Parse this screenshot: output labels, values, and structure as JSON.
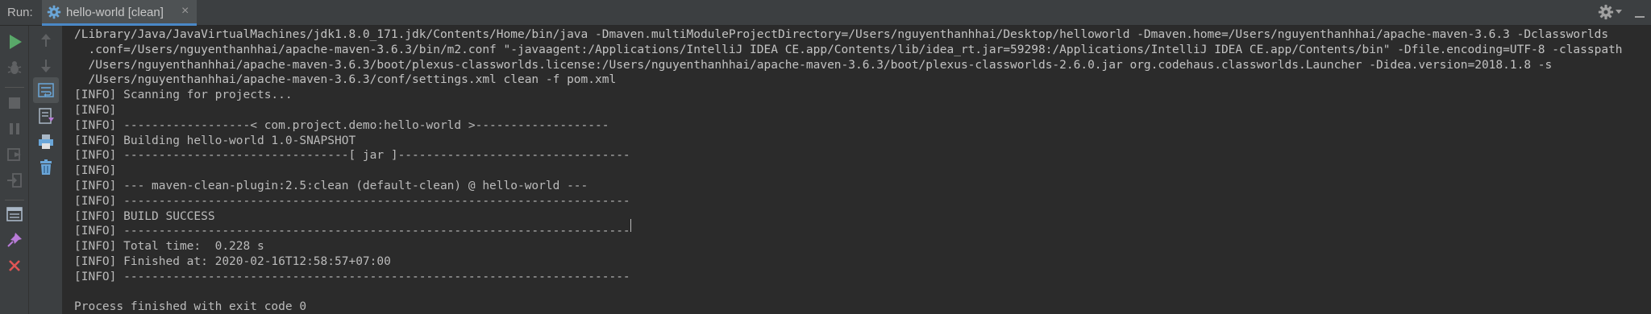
{
  "header": {
    "run_label": "Run:",
    "tab_title": "hello-world [clean]",
    "tab_close": "×",
    "icons": {
      "tab": "gear-icon",
      "settings": "gear-icon",
      "settings_dropdown": "chevron-down-icon",
      "hide": "hide-panel-icon"
    }
  },
  "left_toolbar": {
    "buttons": [
      {
        "name": "rerun-icon",
        "color": "#59a869"
      },
      {
        "name": "debug-disabled-icon",
        "color": "#6e6e6e"
      },
      {
        "name": "stop-icon",
        "color": "#6e6e6e"
      },
      {
        "name": "pause-icon",
        "color": "#6e6e6e"
      },
      {
        "name": "restore-layout-icon",
        "color": "#6e6e6e"
      },
      {
        "name": "login-icon",
        "color": "#6e6e6e"
      },
      {
        "name": "layout-icon",
        "color": "#a9b7c6"
      },
      {
        "name": "pin-icon",
        "color": "#b97cd9"
      },
      {
        "name": "close-icon",
        "color": "#e05555"
      }
    ]
  },
  "second_toolbar": {
    "buttons": [
      {
        "name": "up-arrow-icon"
      },
      {
        "name": "down-arrow-icon"
      },
      {
        "name": "soft-wrap-icon"
      },
      {
        "name": "scroll-to-end-icon"
      },
      {
        "name": "print-icon"
      },
      {
        "name": "trash-icon"
      }
    ]
  },
  "console": {
    "lines": [
      "/Library/Java/JavaVirtualMachines/jdk1.8.0_171.jdk/Contents/Home/bin/java -Dmaven.multiModuleProjectDirectory=/Users/nguyenthanhhai/Desktop/helloworld -Dmaven.home=/Users/nguyenthanhhai/apache-maven-3.6.3 -Dclassworlds",
      "  .conf=/Users/nguyenthanhhai/apache-maven-3.6.3/bin/m2.conf \"-javaagent:/Applications/IntelliJ IDEA CE.app/Contents/lib/idea_rt.jar=59298:/Applications/IntelliJ IDEA CE.app/Contents/bin\" -Dfile.encoding=UTF-8 -classpath",
      "  /Users/nguyenthanhhai/apache-maven-3.6.3/boot/plexus-classworlds.license:/Users/nguyenthanhhai/apache-maven-3.6.3/boot/plexus-classworlds-2.6.0.jar org.codehaus.classworlds.Launcher -Didea.version=2018.1.8 -s",
      "  /Users/nguyenthanhhai/apache-maven-3.6.3/conf/settings.xml clean -f pom.xml",
      "[INFO] Scanning for projects...",
      "[INFO]",
      "[INFO] ------------------< com.project.demo:hello-world >-------------------",
      "[INFO] Building hello-world 1.0-SNAPSHOT",
      "[INFO] --------------------------------[ jar ]---------------------------------",
      "[INFO]",
      "[INFO] --- maven-clean-plugin:2.5:clean (default-clean) @ hello-world ---",
      "[INFO] ------------------------------------------------------------------------",
      "[INFO] BUILD SUCCESS",
      "[INFO] ------------------------------------------------------------------------",
      "[INFO] Total time:  0.228 s",
      "[INFO] Finished at: 2020-02-16T12:58:57+07:00",
      "[INFO] ------------------------------------------------------------------------",
      "",
      "Process finished with exit code 0"
    ]
  },
  "colors": {
    "background": "#2b2b2b",
    "toolbar": "#3c3f41",
    "text": "#bbbbbb",
    "run_green": "#59a869",
    "tab_accent": "#4a88c7"
  }
}
